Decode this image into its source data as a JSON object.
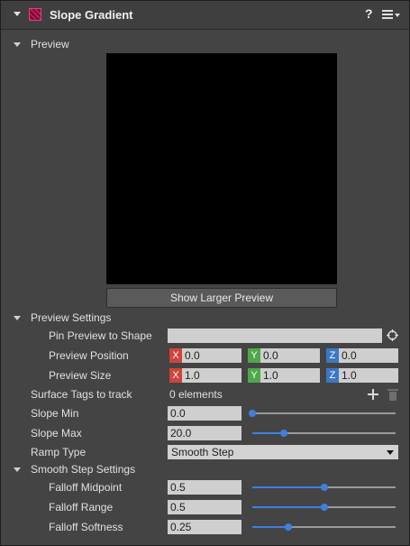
{
  "header": {
    "title": "Slope Gradient",
    "help_label": "?"
  },
  "preview": {
    "section_label": "Preview",
    "show_larger_label": "Show Larger Preview"
  },
  "preview_settings": {
    "section_label": "Preview Settings",
    "pin_label": "Pin Preview to Shape",
    "pin_value": "",
    "position_label": "Preview Position",
    "position": {
      "x": "0.0",
      "y": "0.0",
      "z": "0.0"
    },
    "size_label": "Preview Size",
    "size": {
      "x": "1.0",
      "y": "1.0",
      "z": "1.0"
    },
    "axis_labels": {
      "x": "X",
      "y": "Y",
      "z": "Z"
    }
  },
  "surface_tags": {
    "label": "Surface Tags to track",
    "value": "0 elements"
  },
  "slope_min": {
    "label": "Slope Min",
    "value": "0.0",
    "slider_fraction": 0.0
  },
  "slope_max": {
    "label": "Slope Max",
    "value": "20.0",
    "slider_fraction": 0.22
  },
  "ramp_type": {
    "label": "Ramp Type",
    "value": "Smooth Step"
  },
  "smooth_step": {
    "section_label": "Smooth Step Settings",
    "midpoint": {
      "label": "Falloff Midpoint",
      "value": "0.5",
      "slider_fraction": 0.5
    },
    "range": {
      "label": "Falloff Range",
      "value": "0.5",
      "slider_fraction": 0.5
    },
    "softness": {
      "label": "Falloff Softness",
      "value": "0.25",
      "slider_fraction": 0.25
    }
  },
  "colors": {
    "accent": "#3f7fe0",
    "axis_x": "#d0443a",
    "axis_y": "#4ea849",
    "axis_z": "#3b78c5"
  }
}
